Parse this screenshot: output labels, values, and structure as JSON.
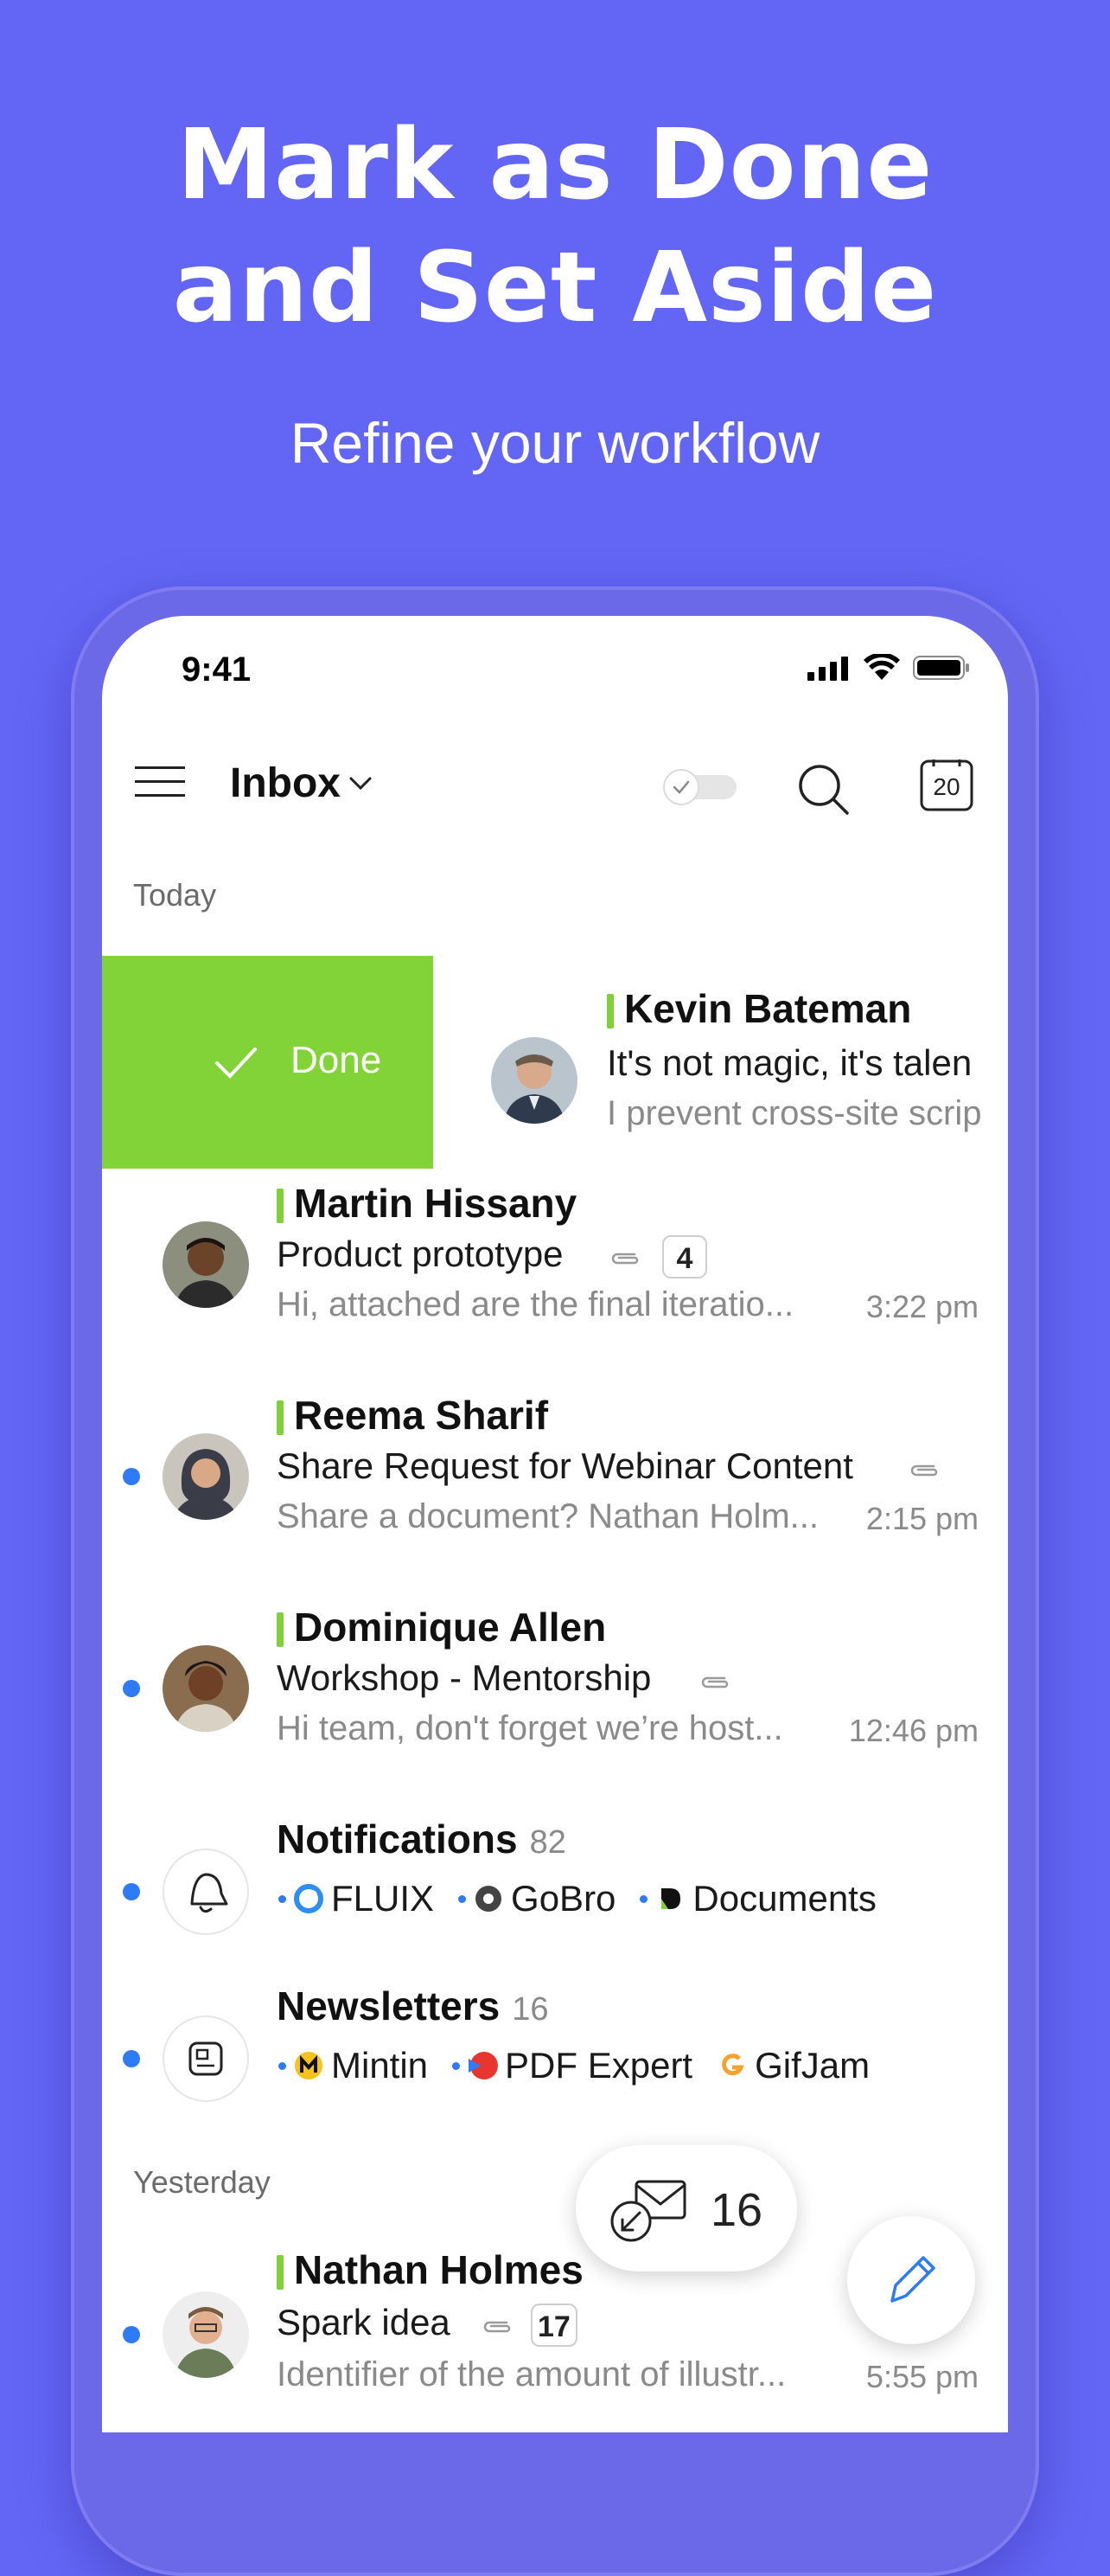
{
  "promo": {
    "headline_line1": "Mark as Done",
    "headline_line2": "and Set Aside",
    "subheadline": "Refine your workflow"
  },
  "status_bar": {
    "time": "9:41"
  },
  "header": {
    "title": "Inbox",
    "calendar_day": "20"
  },
  "sections": {
    "today": "Today",
    "yesterday": "Yesterday"
  },
  "swipe_action": {
    "label": "Done",
    "color": "#82d337"
  },
  "messages": [
    {
      "sender": "Kevin Bateman",
      "subject": "It's not magic, it's talen",
      "preview": "I prevent cross-site scrip",
      "unread": false
    },
    {
      "sender": "Martin Hissany",
      "subject": "Product prototype",
      "preview": "Hi, attached are the final iteratio...",
      "time": "3:22 pm",
      "count": "4",
      "attachment": true,
      "unread": false
    },
    {
      "sender": "Reema Sharif",
      "subject": "Share Request for Webinar Content",
      "preview": "Share a document? Nathan Holm...",
      "time": "2:15 pm",
      "attachment": true,
      "unread": true
    },
    {
      "sender": "Dominique Allen",
      "subject": "Workshop - Mentorship",
      "preview": "Hi team, don't forget we’re host...",
      "time": "12:46 pm",
      "attachment": true,
      "unread": true
    }
  ],
  "groups": [
    {
      "name": "Notifications",
      "count": "82",
      "icon": "bell-icon",
      "apps": [
        "FLUIX",
        "GoBro",
        "Documents"
      ]
    },
    {
      "name": "Newsletters",
      "count": "16",
      "icon": "newspaper-icon",
      "apps": [
        "Mintin",
        "PDF Expert",
        "GifJam"
      ]
    }
  ],
  "yesterday_messages": [
    {
      "sender": "Nathan Holmes",
      "subject": "Spark idea",
      "preview": "Identifier of the amount of illustr...",
      "time": "5:55 pm",
      "count": "17",
      "attachment": true,
      "unread": true
    }
  ],
  "floating": {
    "set_aside_count": "16"
  },
  "colors": {
    "background": "#6366f5",
    "accent_green": "#7fd03a",
    "unread_blue": "#2f7bf5"
  }
}
